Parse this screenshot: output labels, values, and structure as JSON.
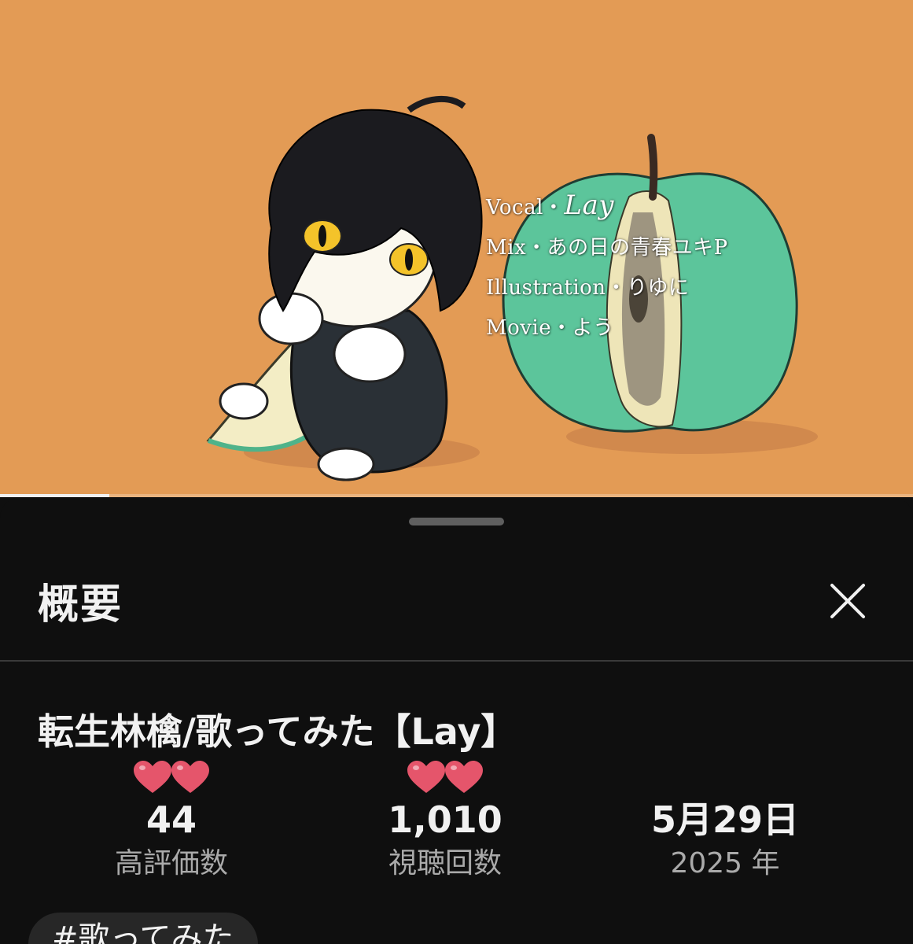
{
  "video": {
    "credits": {
      "vocal_label": "Vocal・",
      "vocal_name": "Lay",
      "mix": "Mix・あの日の青春ユキP",
      "illustration": "Illustration・りゆに",
      "movie": "Movie・よう"
    },
    "progress_fraction": 0.12,
    "background_color": "#e39b55"
  },
  "sheet": {
    "title": "概要",
    "close_icon": "close-icon",
    "video_title": "転生林檎/歌ってみた【Lay】",
    "stats": {
      "likes": {
        "value": "44",
        "label": "高評価数",
        "decoration": "two-hearts"
      },
      "views": {
        "value": "1,010",
        "label": "視聴回数",
        "decoration": "two-hearts"
      },
      "date": {
        "value": "5月29日",
        "label": "2025 年"
      }
    },
    "hashtag_chip": "#歌ってみた"
  },
  "colors": {
    "sheet_background": "#0f0f0f",
    "primary_text": "#f1f1f1",
    "secondary_text": "#aaaaaa",
    "heart": "#e5556b",
    "chip_background": "#272727"
  }
}
